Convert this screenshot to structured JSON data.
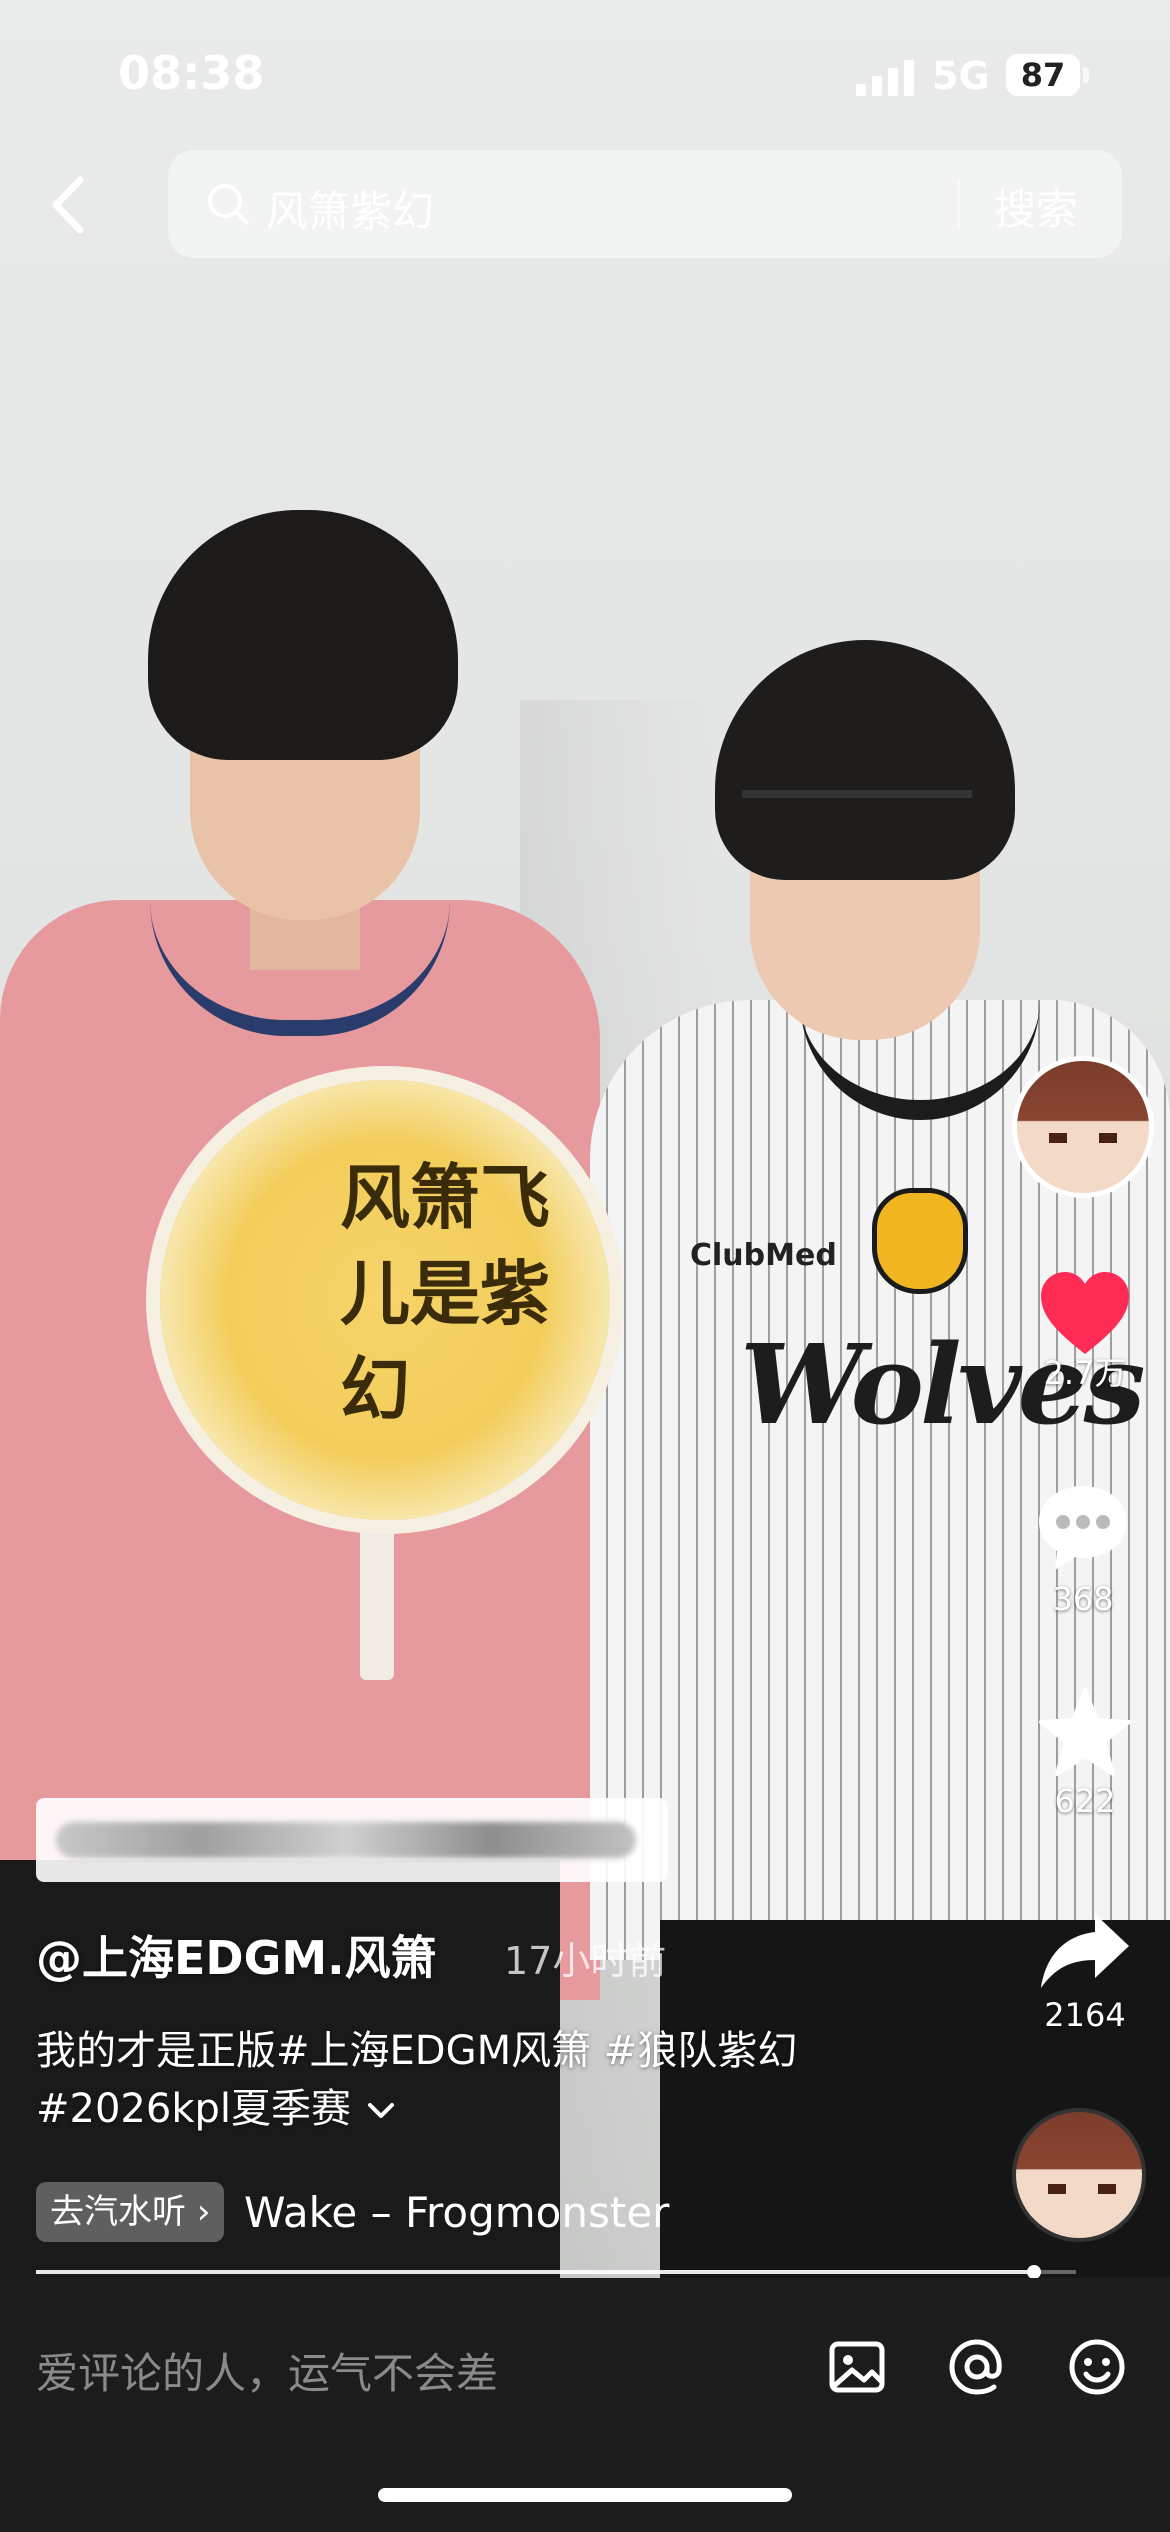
{
  "status_bar": {
    "time": "08:38",
    "network": "5G",
    "battery": "87"
  },
  "search": {
    "query": "风箫紫幻",
    "button": "搜索"
  },
  "video": {
    "fan_text": "风箫飞儿是紫幻",
    "jersey_text": "Wolves",
    "sponsor_text": "ClubMed"
  },
  "rail": {
    "likes": "2.7万",
    "comments": "368",
    "favorites": "622",
    "shares": "2164"
  },
  "post": {
    "author": "@上海EDGM.风箫",
    "time_ago": "17小时前",
    "description_line1": "我的才是正版#上海EDGM风箫 #狼队紫幻",
    "description_line2": "#2026kpl夏季赛",
    "music_chip": "去汽水听",
    "music_song": "Wake – Frogmonster",
    "progress": 0.96
  },
  "comment_bar": {
    "placeholder": "爱评论的人，运气不会差"
  },
  "colors": {
    "like": "#fe2c55",
    "background": "#1c1c1c"
  }
}
